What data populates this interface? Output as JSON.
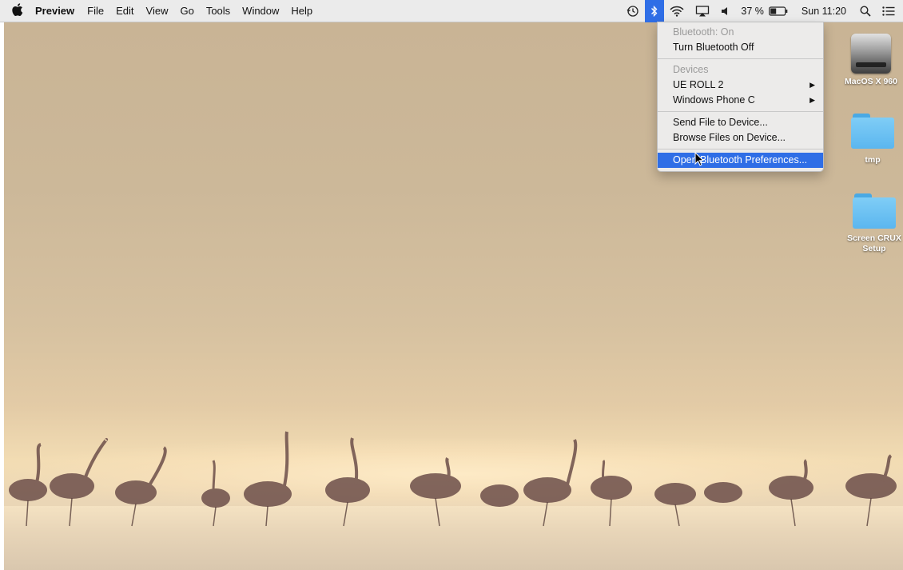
{
  "menubar": {
    "app_name": "Preview",
    "menus": [
      "File",
      "Edit",
      "View",
      "Go",
      "Tools",
      "Window",
      "Help"
    ],
    "status": {
      "battery_percent": "37 %",
      "clock": "Sun 11:20"
    }
  },
  "bluetooth_menu": {
    "status_label": "Bluetooth: On",
    "toggle_label": "Turn Bluetooth Off",
    "devices_header": "Devices",
    "devices": [
      {
        "name": "UE ROLL 2"
      },
      {
        "name": "Windows Phone C"
      }
    ],
    "send_file": "Send File to Device...",
    "browse_files": "Browse Files on Device...",
    "open_prefs": "Open Bluetooth Preferences..."
  },
  "desktop_icons": [
    {
      "label": "MacOS X 960",
      "icon": "hard-drive-icon"
    },
    {
      "label": "tmp",
      "icon": "folder-icon"
    },
    {
      "label": "Screen CRUX Setup",
      "icon": "folder-icon"
    }
  ],
  "colors": {
    "accent": "#2f6ee6",
    "folder": "#5bb6ef"
  }
}
